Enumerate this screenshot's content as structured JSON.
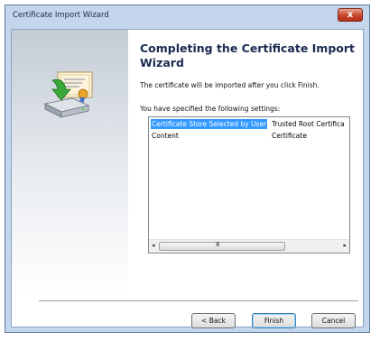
{
  "window": {
    "title": "Certificate Import Wizard",
    "close_label": "x"
  },
  "main": {
    "heading": "Completing the Certificate Import Wizard",
    "description": "The certificate will be imported after you click Finish.",
    "settings_label": "You have specified the following settings:"
  },
  "settings_list": {
    "rows": [
      {
        "name": "Certificate Store Selected by User",
        "value": "Trusted Root Certifica"
      },
      {
        "name": "Content",
        "value": "Certificate"
      }
    ],
    "scroll_left": "◂",
    "scroll_right": "▸",
    "grip": "III"
  },
  "buttons": {
    "back": "< Back",
    "finish": "Finish",
    "cancel": "Cancel"
  },
  "icons": [
    "certificate-icon",
    "green-arrow-icon",
    "drive-icon",
    "close-icon"
  ]
}
